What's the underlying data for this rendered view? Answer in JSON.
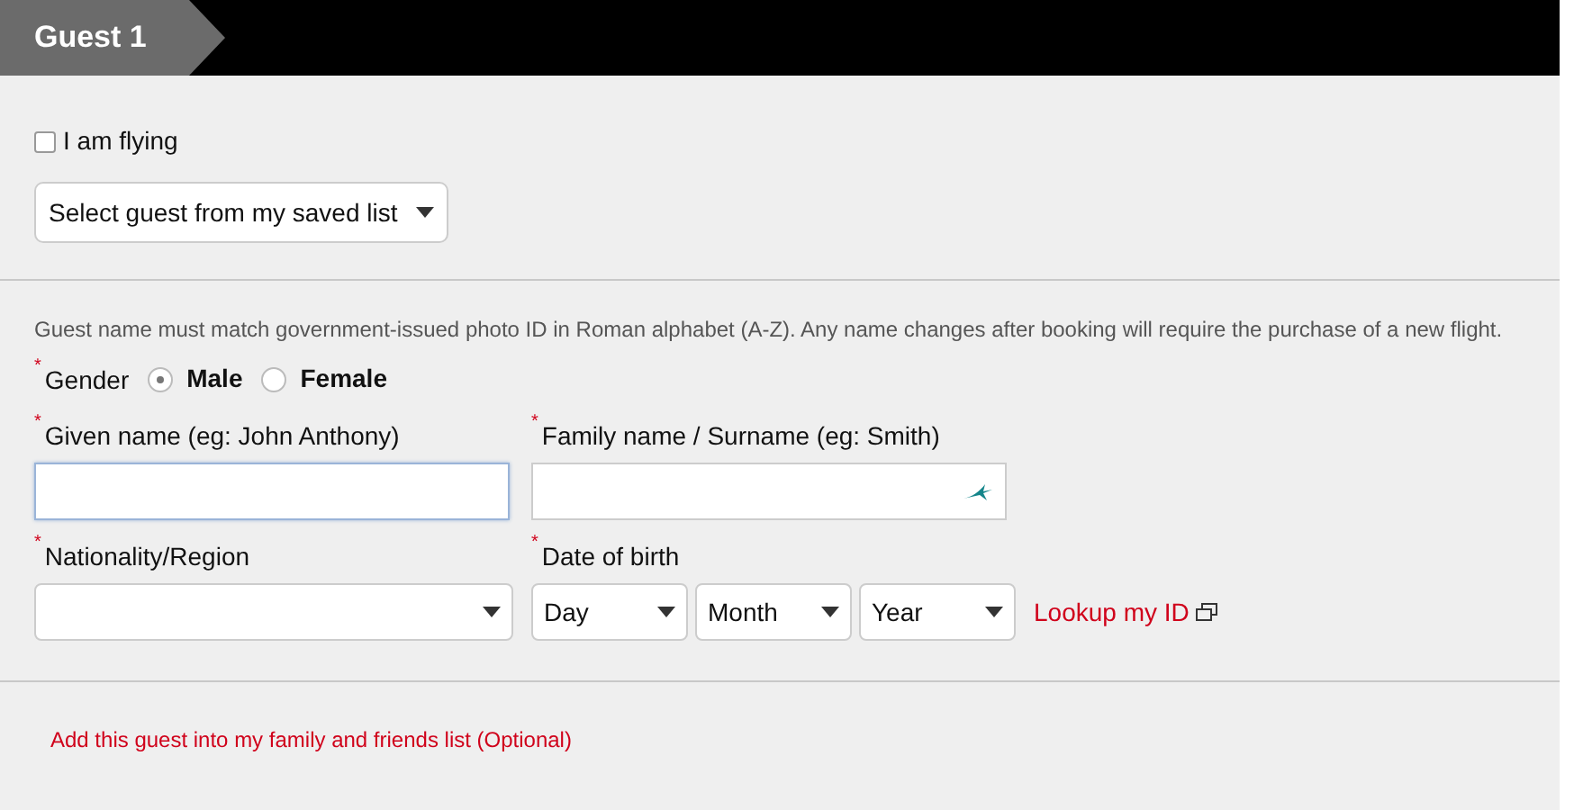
{
  "header": {
    "title": "Guest 1"
  },
  "flying": {
    "label": "I am flying",
    "checked": false
  },
  "saved_list": {
    "value": "Select guest from my saved list"
  },
  "notice": "Guest name must match government-issued photo ID in Roman alphabet (A-Z). Any name changes after booking will require the purchase of a new flight.",
  "gender": {
    "mark": "*",
    "label": "Gender",
    "options": [
      {
        "label": "Male",
        "selected": true
      },
      {
        "label": "Female",
        "selected": false
      }
    ]
  },
  "given_name": {
    "mark": "*",
    "label": "Given name (eg: John Anthony)",
    "focused": true
  },
  "family_name": {
    "mark": "*",
    "label": "Family name / Surname (eg: Smith)",
    "focused": false
  },
  "nationality": {
    "mark": "*",
    "label": "Nationality/Region"
  },
  "date_of_birth": {
    "mark": "*",
    "label": "Date of birth",
    "selects": [
      "Day",
      "Month",
      "Year"
    ]
  },
  "lookup_link": "Lookup my ID",
  "add_link": "Add this guest into my family and friends list (Optional)"
}
